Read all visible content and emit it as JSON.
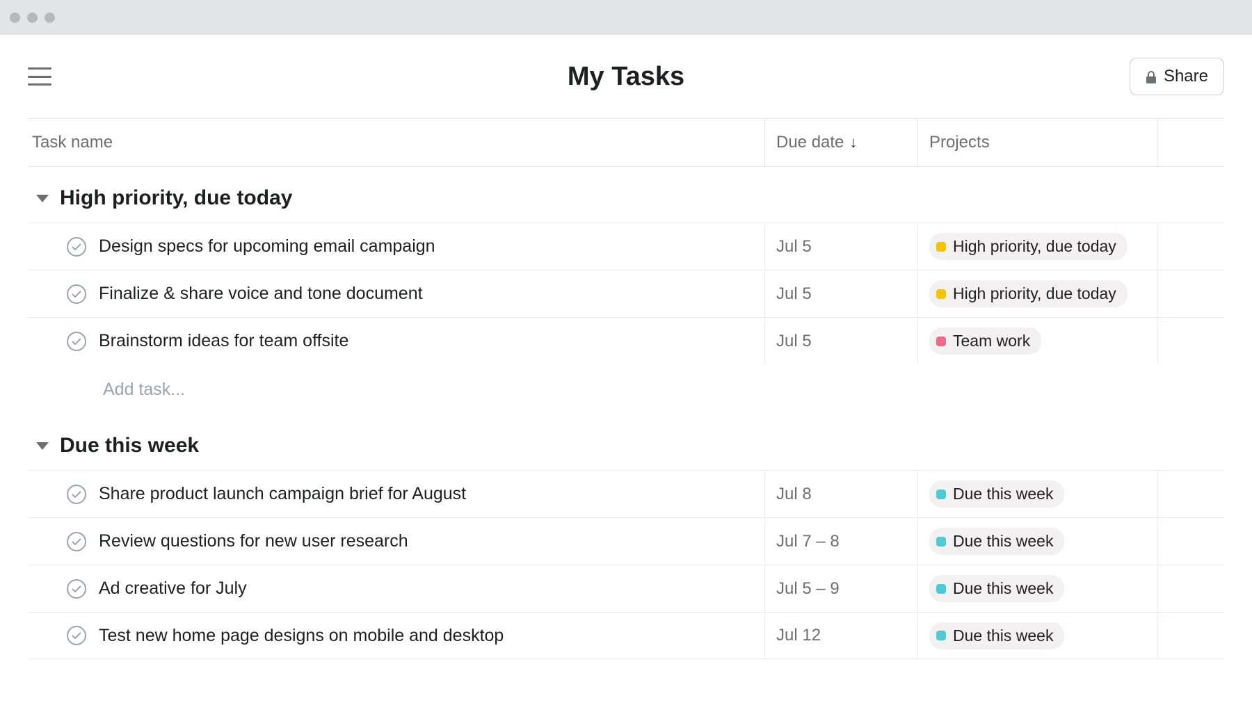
{
  "header": {
    "title": "My Tasks",
    "share_label": "Share"
  },
  "columns": {
    "name": "Task name",
    "due": "Due date",
    "projects": "Projects"
  },
  "sections": [
    {
      "title": "High priority, due today",
      "tasks": [
        {
          "name": "Design specs for upcoming email campaign",
          "due": "Jul 5",
          "tag": {
            "label": "High priority, due today",
            "color": "yellow"
          }
        },
        {
          "name": "Finalize & share voice and tone document",
          "due": "Jul 5",
          "tag": {
            "label": "High priority, due today",
            "color": "yellow"
          }
        },
        {
          "name": "Brainstorm ideas for team offsite",
          "due": "Jul 5",
          "tag": {
            "label": "Team work",
            "color": "pink"
          }
        }
      ],
      "add_placeholder": "Add task..."
    },
    {
      "title": "Due this week",
      "tasks": [
        {
          "name": "Share product launch campaign brief for August",
          "due": "Jul 8",
          "tag": {
            "label": "Due this week",
            "color": "cyan"
          }
        },
        {
          "name": "Review questions for new user research",
          "due": "Jul 7 – 8",
          "tag": {
            "label": "Due this week",
            "color": "cyan"
          }
        },
        {
          "name": "Ad creative for July",
          "due": "Jul 5 – 9",
          "tag": {
            "label": "Due this week",
            "color": "cyan"
          }
        },
        {
          "name": "Test new home page designs on mobile and desktop",
          "due": "Jul 12",
          "tag": {
            "label": "Due this week",
            "color": "cyan"
          }
        }
      ]
    }
  ]
}
